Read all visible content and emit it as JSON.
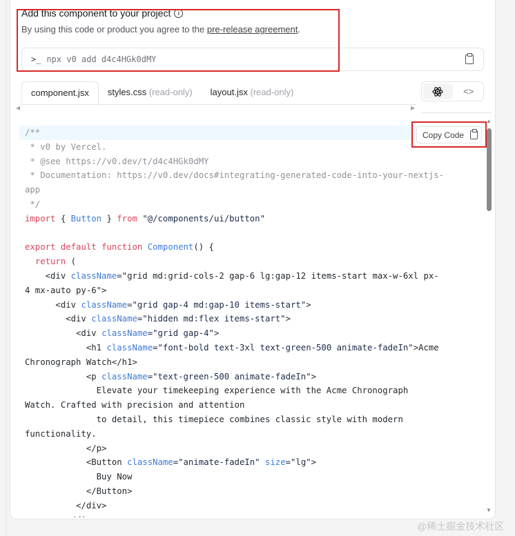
{
  "project": {
    "title": "Add this component to your project",
    "agree_prefix": "By using this code or product you agree to the ",
    "agree_link": "pre-release agreement",
    "agree_suffix": ".",
    "command": "npx v0 add d4c4HGk0dMY"
  },
  "tabs": [
    {
      "label": "component.jsx",
      "suffix": ""
    },
    {
      "label": "styles.css",
      "suffix": "(read-only)"
    },
    {
      "label": "layout.jsx",
      "suffix": "(read-only)"
    }
  ],
  "copy_code_label": "Copy Code",
  "code_lines": [
    "/**",
    " * v0 by Vercel.",
    " * @see https://v0.dev/t/d4c4HGk0dMY",
    " * Documentation: https://v0.dev/docs#integrating-generated-code-into-your-nextjs-",
    "app",
    " */",
    "import { Button } from \"@/components/ui/button\"",
    "",
    "export default function Component() {",
    "  return (",
    "    <div className=\"grid md:grid-cols-2 gap-6 lg:gap-12 items-start max-w-6xl px-",
    "4 mx-auto py-6\">",
    "      <div className=\"grid gap-4 md:gap-10 items-start\">",
    "        <div className=\"hidden md:flex items-start\">",
    "          <div className=\"grid gap-4\">",
    "            <h1 className=\"font-bold text-3xl text-green-500 animate-fadeIn\">Acme",
    "Chronograph Watch</h1>",
    "            <p className=\"text-green-500 animate-fadeIn\">",
    "              Elevate your timekeeping experience with the Acme Chronograph",
    "Watch. Crafted with precision and attention",
    "              to detail, this timepiece combines classic style with modern",
    "functionality.",
    "            </p>",
    "            <Button className=\"animate-fadeIn\" size=\"lg\">",
    "              Buy Now",
    "            </Button>",
    "          </div>",
    "        </div>"
  ],
  "watermark": "@稀土掘金技术社区"
}
